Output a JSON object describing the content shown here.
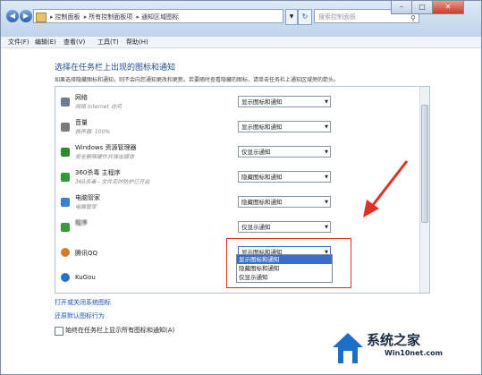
{
  "breadcrumb": [
    "控制面板",
    "所有控制面板项",
    "通知区域图标"
  ],
  "search_placeholder": "搜索控制面板",
  "window_controls": [
    "–",
    "□",
    "✕"
  ],
  "menu": [
    "文件(F)",
    "编辑(E)",
    "查看(V)",
    "工具(T)",
    "帮助(H)"
  ],
  "heading": "选择在任务栏上出现的图标和通知",
  "description": "如果选择隐藏图标和通知，则不会向您通知更改和更新。若要随时查看隐藏的图标，请单击任务栏上通知区域旁的箭头。",
  "items": [
    {
      "name": "网络",
      "sub": "网络 Internet 访问",
      "value": "显示图标和通知",
      "color": "#6b7d93"
    },
    {
      "name": "音量",
      "sub": "扬声器: 100%",
      "value": "显示图标和通知",
      "color": "#7a7a7a"
    },
    {
      "name": "Windows 资源管理器",
      "sub": "安全删除硬件并弹出媒体",
      "value": "仅显示通知",
      "color": "#2f8a2f"
    },
    {
      "name": "360杀毒 主程序",
      "sub": "360杀毒 - 文件实时防护已开启",
      "value": "隐藏图标和通知",
      "color": "#2f9a3a"
    },
    {
      "name": "电脑管家",
      "sub": "电脑管家",
      "value": "隐藏图标和通知",
      "color": "#3a7fd0"
    },
    {
      "name": "程序",
      "sub": "",
      "value": "仅显示通知",
      "color": "#3a9a3a"
    },
    {
      "name": "腾讯QQ",
      "sub": "",
      "value": "显示图标和通知",
      "color": "#d87a2a"
    },
    {
      "name": "KuGou",
      "sub": "",
      "value": "",
      "color": "#2a6fc8"
    }
  ],
  "dropdown_options": [
    "显示图标和通知",
    "隐藏图标和通知",
    "仅显示通知"
  ],
  "links": [
    "打开或关闭系统图标",
    "还原默认图标行为"
  ],
  "checkbox_label": "始终在任务栏上显示所有图标和通知(A)",
  "watermark": {
    "cn": "系统之家",
    "url": "Win10net.com"
  }
}
